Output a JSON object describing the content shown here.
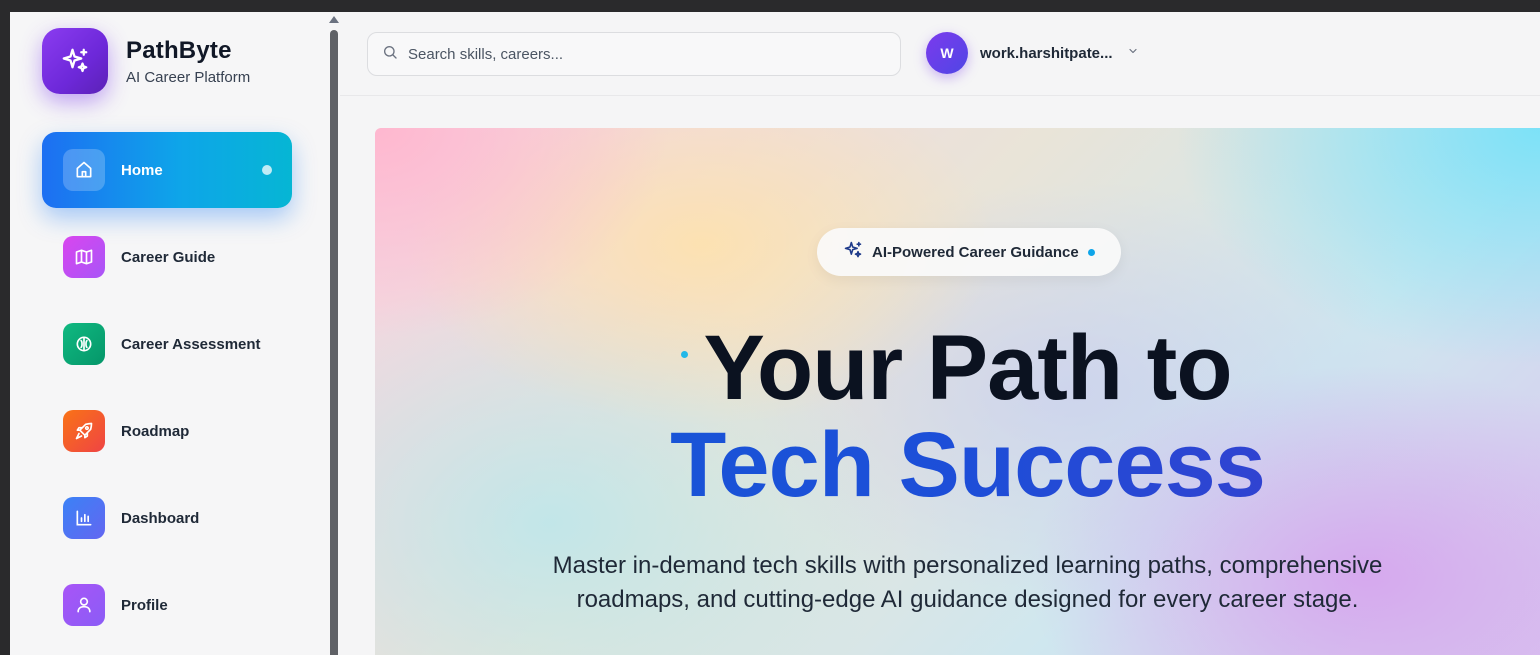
{
  "brand": {
    "name": "PathByte",
    "subtitle": "AI Career Platform",
    "logo_icon": "sparkles-icon"
  },
  "sidebar": {
    "items": [
      {
        "label": "Home",
        "icon": "home-icon",
        "active": true,
        "color": "#1d6ff2"
      },
      {
        "label": "Career Guide",
        "icon": "map-icon",
        "active": false,
        "color": "#c34ad9"
      },
      {
        "label": "Career Assessment",
        "icon": "brain-icon",
        "active": false,
        "color": "#10b981"
      },
      {
        "label": "Roadmap",
        "icon": "rocket-icon",
        "active": false,
        "color": "#f25a2c"
      },
      {
        "label": "Dashboard",
        "icon": "bar-chart-icon",
        "active": false,
        "color": "#5b7cf5"
      },
      {
        "label": "Profile",
        "icon": "user-icon",
        "active": false,
        "color": "#8b5cf6"
      }
    ]
  },
  "search": {
    "placeholder": "Search skills, careers...",
    "value": ""
  },
  "user": {
    "initial": "W",
    "name": "work.harshitpate..."
  },
  "hero": {
    "badge": "AI-Powered Career Guidance",
    "headline_line1": "Your Path to",
    "headline_line2": "Tech Success",
    "description": "Master in-demand tech skills with personalized learning paths, comprehensive roadmaps, and cutting-edge AI guidance designed for every career stage."
  },
  "colors": {
    "accent_blue": "#1d6ff2",
    "accent_cyan": "#06b6d4",
    "brand_purple": "#7c3aed",
    "headline_blue": "#1d4ed8"
  }
}
